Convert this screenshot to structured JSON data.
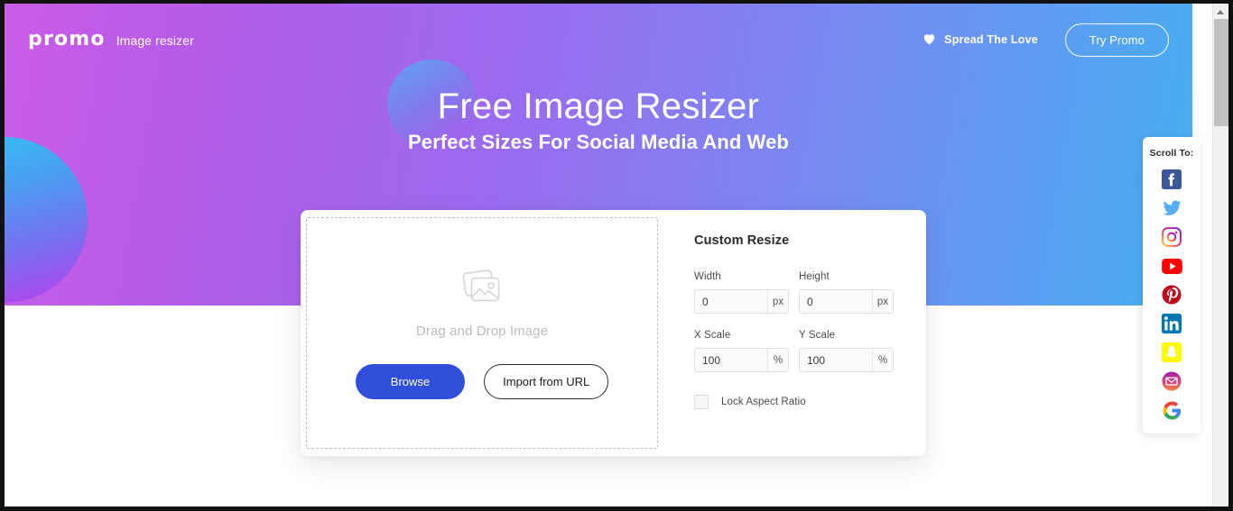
{
  "nav": {
    "logo_text": "promo",
    "app_name": "Image resizer",
    "heart_icon": "heart-icon",
    "spread_love_label": "Spread The Love",
    "try_promo_label": "Try Promo"
  },
  "hero": {
    "title": "Free Image Resizer",
    "subtitle": "Perfect Sizes For Social Media And Web",
    "gradient_from": "#cb5ce6",
    "gradient_to": "#46b0f0"
  },
  "dropzone": {
    "icon": "image-stack-icon",
    "label": "Drag and Drop Image",
    "browse_label": "Browse",
    "import_url_label": "Import from URL",
    "browse_color": "#2f4fdb"
  },
  "resize_panel": {
    "title": "Custom Resize",
    "fields": [
      {
        "label": "Width",
        "value": "0",
        "placeholder": "0",
        "suffix": "px"
      },
      {
        "label": "Height",
        "value": "0",
        "placeholder": "0",
        "suffix": "px"
      },
      {
        "label": "X Scale",
        "value": "100",
        "placeholder": "100",
        "suffix": "%"
      },
      {
        "label": "Y Scale",
        "value": "100",
        "placeholder": "100",
        "suffix": "%"
      }
    ],
    "lock_label": "Lock Aspect Ratio",
    "lock_checked": false
  },
  "social_rail": {
    "title": "Scroll To:",
    "items": [
      {
        "name": "facebook",
        "label": "Facebook"
      },
      {
        "name": "twitter",
        "label": "Twitter"
      },
      {
        "name": "instagram",
        "label": "Instagram"
      },
      {
        "name": "youtube",
        "label": "YouTube"
      },
      {
        "name": "pinterest",
        "label": "Pinterest"
      },
      {
        "name": "linkedin",
        "label": "LinkedIn"
      },
      {
        "name": "snapchat",
        "label": "Snapchat"
      },
      {
        "name": "email",
        "label": "Email"
      },
      {
        "name": "google",
        "label": "Google"
      }
    ]
  },
  "scrollbar": {
    "up_arrow_icon": "scroll-up-arrow-icon"
  }
}
